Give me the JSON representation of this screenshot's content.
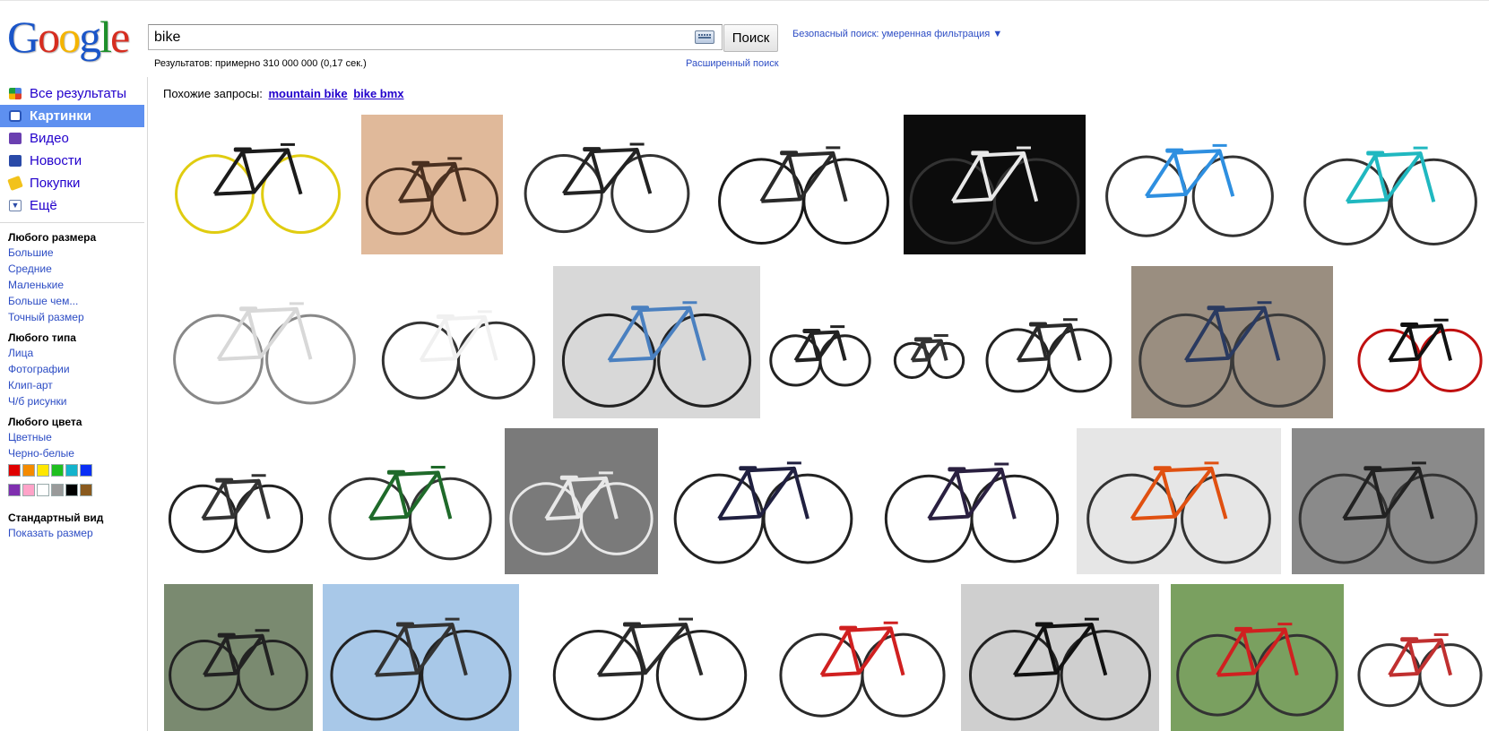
{
  "logo": {
    "letters": [
      "G",
      "o",
      "o",
      "g",
      "l",
      "e"
    ],
    "colors": [
      "#1a55c8",
      "#d62d20",
      "#f4b400",
      "#1a55c8",
      "#1e8f2b",
      "#d62d20"
    ]
  },
  "search": {
    "query": "bike",
    "button": "Поиск"
  },
  "safe_search": "Безопасный поиск: умеренная фильтрация ▼",
  "results_stats": "Результатов: примерно 310 000 000 (0,17 сек.)",
  "advanced_search": "Расширенный поиск",
  "nav": [
    {
      "label": "Все результаты",
      "icon": "google-icon"
    },
    {
      "label": "Картинки",
      "icon": "camera-icon",
      "selected": true
    },
    {
      "label": "Видео",
      "icon": "film-icon"
    },
    {
      "label": "Новости",
      "icon": "newspaper-icon"
    },
    {
      "label": "Покупки",
      "icon": "tag-icon"
    },
    {
      "label": "Ещё",
      "icon": "chevron-down-icon"
    }
  ],
  "filters": {
    "size": {
      "heading": "Любого размера",
      "items": [
        "Большие",
        "Средние",
        "Маленькие",
        "Больше чем...",
        "Точный размер"
      ]
    },
    "type": {
      "heading": "Любого типа",
      "items": [
        "Лица",
        "Фотографии",
        "Клип-арт",
        "Ч/б рисунки"
      ]
    },
    "color": {
      "heading": "Любого цвета",
      "items": [
        "Цветные",
        "Черно-белые"
      ],
      "swatches": [
        "#e00000",
        "#f58b00",
        "#ffe700",
        "#1fbf1f",
        "#13b3cc",
        "#0a2ff5",
        "#7f2faf",
        "#ffa3c8",
        "#ffffff",
        "#9a9a9a",
        "#000000",
        "#8a5a1e"
      ]
    },
    "view": {
      "heading": "Стандартный вид",
      "items": [
        "Показать размер"
      ]
    }
  },
  "related": {
    "prefix": "Похожие запросы:",
    "links": [
      "mountain bike",
      "bike bmx"
    ]
  },
  "colors": {
    "link": "#2200cc",
    "accent": "#5e90f0"
  },
  "images": [
    {
      "row": 1,
      "bg": "#ffffff",
      "frame": "#1b1b1b",
      "wheel": "#e0cc10"
    },
    {
      "row": 1,
      "bg": "#e0b99a",
      "frame": "#4a3020",
      "wheel": "#4a3020"
    },
    {
      "row": 1,
      "bg": "#ffffff",
      "frame": "#222222",
      "wheel": "#333333"
    },
    {
      "row": 1,
      "bg": "#ffffff",
      "frame": "#2a2a2a",
      "wheel": "#1a1a1a"
    },
    {
      "row": 1,
      "bg": "#0c0c0c",
      "frame": "#e8e8e8",
      "wheel": "#333333"
    },
    {
      "row": 1,
      "bg": "#ffffff",
      "frame": "#2e8fe0",
      "wheel": "#333333"
    },
    {
      "row": 1,
      "bg": "#ffffff",
      "frame": "#20b8c0",
      "wheel": "#333333"
    },
    {
      "row": 2,
      "bg": "#ffffff",
      "frame": "#d8d8d8",
      "wheel": "#888888"
    },
    {
      "row": 2,
      "bg": "#ffffff",
      "frame": "#f0f0f0",
      "wheel": "#333333"
    },
    {
      "row": 2,
      "bg": "#d8d8d8",
      "frame": "#4a80c0",
      "wheel": "#222222"
    },
    {
      "row": 2,
      "bg": "#ffffff",
      "frame": "#222222",
      "wheel": "#222222"
    },
    {
      "row": 2,
      "bg": "#ffffff",
      "frame": "#333333",
      "wheel": "#222222"
    },
    {
      "row": 2,
      "bg": "#ffffff",
      "frame": "#2a2a2a",
      "wheel": "#222222"
    },
    {
      "row": 2,
      "bg": "#9a8e80",
      "frame": "#2a3a60",
      "wheel": "#3a3a3a"
    },
    {
      "row": 2,
      "bg": "#ffffff",
      "frame": "#111111",
      "wheel": "#c01010"
    },
    {
      "row": 3,
      "bg": "#ffffff",
      "frame": "#333333",
      "wheel": "#222222"
    },
    {
      "row": 3,
      "bg": "#ffffff",
      "frame": "#1f6a2a",
      "wheel": "#333333"
    },
    {
      "row": 3,
      "bg": "#7a7a7a",
      "frame": "#e8e8e8",
      "wheel": "#e8e8e8"
    },
    {
      "row": 3,
      "bg": "#ffffff",
      "frame": "#202040",
      "wheel": "#222222"
    },
    {
      "row": 3,
      "bg": "#ffffff",
      "frame": "#2a2040",
      "wheel": "#222222"
    },
    {
      "row": 3,
      "bg": "#e6e6e6",
      "frame": "#e05010",
      "wheel": "#333333"
    },
    {
      "row": 3,
      "bg": "#8a8a8a",
      "frame": "#222222",
      "wheel": "#333333"
    },
    {
      "row": 4,
      "bg": "#7a8a70",
      "frame": "#222222",
      "wheel": "#222222"
    },
    {
      "row": 4,
      "bg": "#a8c8e8",
      "frame": "#333333",
      "wheel": "#222222"
    },
    {
      "row": 4,
      "bg": "#ffffff",
      "frame": "#2a2a2a",
      "wheel": "#222222"
    },
    {
      "row": 4,
      "bg": "#ffffff",
      "frame": "#d02020",
      "wheel": "#2a2a2a"
    },
    {
      "row": 4,
      "bg": "#cfcfcf",
      "frame": "#111111",
      "wheel": "#222222"
    },
    {
      "row": 4,
      "bg": "#7aa060",
      "frame": "#d02020",
      "wheel": "#333333"
    },
    {
      "row": 4,
      "bg": "#ffffff",
      "frame": "#c03030",
      "wheel": "#333333"
    }
  ]
}
